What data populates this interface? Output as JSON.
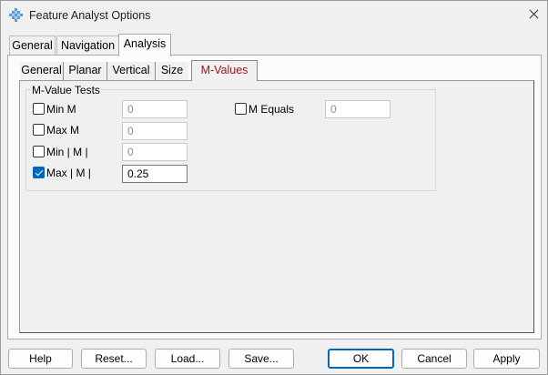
{
  "window": {
    "title": "Feature Analyst Options",
    "icon": "feature-analyst-app-icon",
    "close_icon": "close-icon"
  },
  "outer_tabs": [
    {
      "label": "General",
      "active": false
    },
    {
      "label": "Navigation",
      "active": false
    },
    {
      "label": "Analysis",
      "active": true
    }
  ],
  "inner_tabs": [
    {
      "label": "General",
      "active": false
    },
    {
      "label": "Planar",
      "active": false
    },
    {
      "label": "Vertical",
      "active": false
    },
    {
      "label": "Size",
      "active": false
    },
    {
      "label": "M-Values",
      "active": true
    }
  ],
  "mvalue_tests": {
    "group_title": "M-Value Tests",
    "tests": [
      {
        "label": "Min M",
        "checked": false,
        "value": "0",
        "enabled": false
      },
      {
        "label": "Max M",
        "checked": false,
        "value": "0",
        "enabled": false
      },
      {
        "label": "Min | M |",
        "checked": false,
        "value": "0",
        "enabled": false
      },
      {
        "label": "Max | M |",
        "checked": true,
        "value": "0.25",
        "enabled": true
      }
    ],
    "equals": {
      "label": "M Equals",
      "checked": false,
      "value": "0",
      "enabled": false
    }
  },
  "buttons": {
    "help": "Help",
    "reset": "Reset...",
    "load": "Load...",
    "save": "Save...",
    "ok": "OK",
    "cancel": "Cancel",
    "apply": "Apply"
  },
  "colors": {
    "accent": "#0067c0",
    "active_inner_tab_text": "#a31515"
  }
}
